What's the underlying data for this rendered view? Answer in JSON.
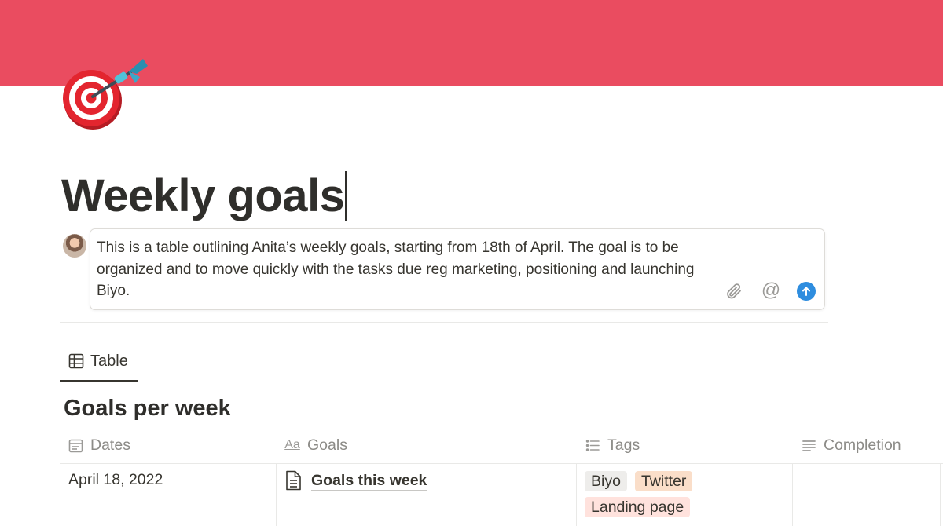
{
  "page": {
    "title": "Weekly goals",
    "icon": "dart-target-icon",
    "cover_color": "#ea4c60"
  },
  "comment": {
    "text": "This is a table outlining Anita’s weekly goals, starting from 18th of April. The goal is to be organized and to move quickly with the tasks due reg marketing, positioning and launching Biyo.",
    "icons": {
      "attach": "paperclip-icon",
      "mention": "@",
      "send": "arrow-up-icon"
    },
    "send_color": "#2e8ddf"
  },
  "view": {
    "tab_label": "Table",
    "tab_icon": "table-icon"
  },
  "database": {
    "title": "Goals per week",
    "columns": [
      {
        "label": "Dates",
        "icon": "calendar-icon"
      },
      {
        "label": "Goals",
        "icon": "text-aa-icon",
        "icon_text": "Aa"
      },
      {
        "label": "Tags",
        "icon": "list-icon"
      },
      {
        "label": "Completion",
        "icon": "text-lines-icon"
      }
    ],
    "rows": [
      {
        "date": "April 18, 2022",
        "goal": "Goals this week",
        "tags": [
          {
            "label": "Biyo",
            "color": "#eeedeb"
          },
          {
            "label": "Twitter",
            "color": "#fadec9"
          },
          {
            "label": "Landing page",
            "color": "#ffe2dd"
          }
        ],
        "completion": ""
      }
    ]
  }
}
